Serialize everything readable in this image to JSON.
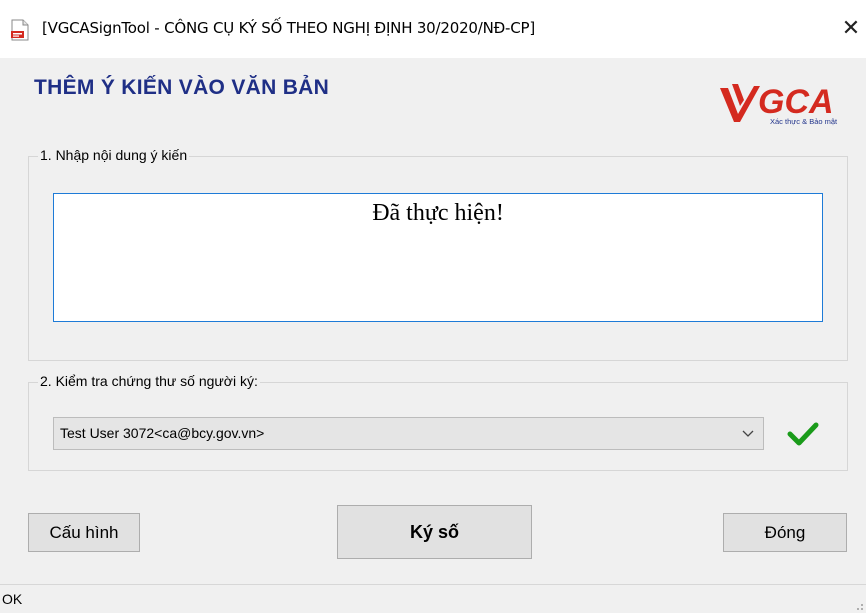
{
  "window": {
    "title": "[VGCASignTool - CÔNG CỤ KÝ SỐ THEO NGHỊ ĐỊNH 30/2020/NĐ-CP]",
    "close_glyph": "✕"
  },
  "header": {
    "title": "THÊM Ý KIẾN VÀO VĂN BẢN",
    "logo": {
      "text": "VGCA",
      "tagline": "Xác thực & Bảo mật",
      "colors": {
        "red": "#d42a1f",
        "blue": "#23358c"
      }
    }
  },
  "section1": {
    "label": "1. Nhập nội dung ý kiến",
    "content": "Đã thực hiện!"
  },
  "section2": {
    "label": "2. Kiểm tra chứng thư số người ký:",
    "selected_cert": "Test User 3072<ca@bcy.gov.vn>",
    "status_icon": "check-icon",
    "status_color": "#1a9b1a"
  },
  "buttons": {
    "config": "Cấu hình",
    "sign": "Ký số",
    "close": "Đóng"
  },
  "statusbar": {
    "text": "OK"
  },
  "colors": {
    "accent": "#1f2f86",
    "input_border": "#1e7bd7"
  }
}
